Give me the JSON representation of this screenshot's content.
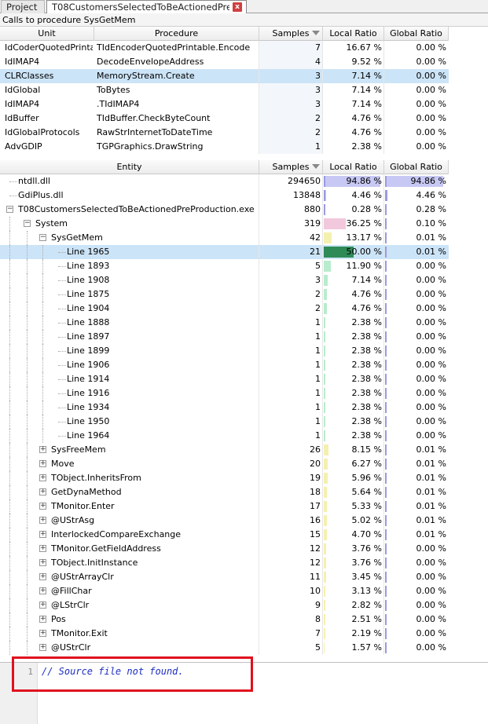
{
  "tabs": {
    "project_label": "Project",
    "active_label": "T08CustomersSelectedToBeActionedPre...",
    "close_glyph": "x"
  },
  "caption": "Calls to procedure SysGetMem",
  "callers": {
    "columns": [
      "Unit",
      "Procedure",
      "Samples",
      "Local Ratio",
      "Global Ratio"
    ],
    "rows": [
      {
        "unit": "IdCoderQuotedPrinta...",
        "procedure": "TIdEncoderQuotedPrintable.Encode",
        "samples": "7",
        "local": "16.67 %",
        "global": "0.00 %",
        "selected": false
      },
      {
        "unit": "IdIMAP4",
        "procedure": "DecodeEnvelopeAddress",
        "samples": "4",
        "local": "9.52 %",
        "global": "0.00 %",
        "selected": false
      },
      {
        "unit": "CLRClasses",
        "procedure": "MemoryStream.Create",
        "samples": "3",
        "local": "7.14 %",
        "global": "0.00 %",
        "selected": true
      },
      {
        "unit": "IdGlobal",
        "procedure": "ToBytes",
        "samples": "3",
        "local": "7.14 %",
        "global": "0.00 %",
        "selected": false
      },
      {
        "unit": "IdIMAP4",
        "procedure": ".TIdIMAP4",
        "samples": "3",
        "local": "7.14 %",
        "global": "0.00 %",
        "selected": false
      },
      {
        "unit": "IdBuffer",
        "procedure": "TIdBuffer.CheckByteCount",
        "samples": "2",
        "local": "4.76 %",
        "global": "0.00 %",
        "selected": false
      },
      {
        "unit": "IdGlobalProtocols",
        "procedure": "RawStrInternetToDateTime",
        "samples": "2",
        "local": "4.76 %",
        "global": "0.00 %",
        "selected": false
      },
      {
        "unit": "AdvGDIP",
        "procedure": "TGPGraphics.DrawString",
        "samples": "1",
        "local": "2.38 %",
        "global": "0.00 %",
        "selected": false
      }
    ]
  },
  "entities": {
    "columns": [
      "Entity",
      "Samples",
      "Local Ratio",
      "Global Ratio"
    ],
    "colors": {
      "blue": "#c8c8f4",
      "pink": "#f2c8dc",
      "yellow": "#f4f0b0",
      "green": "#b8eccc",
      "darkgreen": "#2e8b57",
      "blueline": "#9a9ae0"
    },
    "rows": [
      {
        "name": "ntdll.dll",
        "level": 0,
        "expander": "none",
        "samples": "294650",
        "local": "94.86 %",
        "global": "94.86 %",
        "local_frac": 0.9486,
        "global_frac": 0.9486,
        "color": "blue",
        "selected": false
      },
      {
        "name": "GdiPlus.dll",
        "level": 0,
        "expander": "none",
        "samples": "13848",
        "local": "4.46 %",
        "global": "4.46 %",
        "local_frac": 0.0446,
        "global_frac": 0.0446,
        "color": "blue",
        "selected": false
      },
      {
        "name": "T08CustomersSelectedToBeActionedPreProduction.exe",
        "level": 0,
        "expander": "minus",
        "samples": "880",
        "local": "0.28 %",
        "global": "0.28 %",
        "local_frac": 0.0028,
        "global_frac": 0.0028,
        "color": "blue",
        "selected": false
      },
      {
        "name": "System",
        "level": 1,
        "expander": "minus",
        "samples": "319",
        "local": "36.25 %",
        "global": "0.10 %",
        "local_frac": 0.3625,
        "global_frac": 0.001,
        "color": "pink",
        "selected": false
      },
      {
        "name": "SysGetMem",
        "level": 2,
        "expander": "minus",
        "samples": "42",
        "local": "13.17 %",
        "global": "0.01 %",
        "local_frac": 0.1317,
        "global_frac": 0.0001,
        "color": "yellow",
        "selected": false
      },
      {
        "name": "Line 1965",
        "level": 3,
        "expander": "none",
        "samples": "21",
        "local": "50.00 %",
        "global": "0.01 %",
        "local_frac": 0.5,
        "global_frac": 0.0001,
        "color": "darkgreen",
        "selected": true
      },
      {
        "name": "Line 1893",
        "level": 3,
        "expander": "none",
        "samples": "5",
        "local": "11.90 %",
        "global": "0.00 %",
        "local_frac": 0.119,
        "global_frac": 0,
        "color": "green",
        "selected": false
      },
      {
        "name": "Line 1908",
        "level": 3,
        "expander": "none",
        "samples": "3",
        "local": "7.14 %",
        "global": "0.00 %",
        "local_frac": 0.0714,
        "global_frac": 0,
        "color": "green",
        "selected": false
      },
      {
        "name": "Line 1875",
        "level": 3,
        "expander": "none",
        "samples": "2",
        "local": "4.76 %",
        "global": "0.00 %",
        "local_frac": 0.0476,
        "global_frac": 0,
        "color": "green",
        "selected": false
      },
      {
        "name": "Line 1904",
        "level": 3,
        "expander": "none",
        "samples": "2",
        "local": "4.76 %",
        "global": "0.00 %",
        "local_frac": 0.0476,
        "global_frac": 0,
        "color": "green",
        "selected": false
      },
      {
        "name": "Line 1888",
        "level": 3,
        "expander": "none",
        "samples": "1",
        "local": "2.38 %",
        "global": "0.00 %",
        "local_frac": 0.0238,
        "global_frac": 0,
        "color": "green",
        "selected": false
      },
      {
        "name": "Line 1897",
        "level": 3,
        "expander": "none",
        "samples": "1",
        "local": "2.38 %",
        "global": "0.00 %",
        "local_frac": 0.0238,
        "global_frac": 0,
        "color": "green",
        "selected": false
      },
      {
        "name": "Line 1899",
        "level": 3,
        "expander": "none",
        "samples": "1",
        "local": "2.38 %",
        "global": "0.00 %",
        "local_frac": 0.0238,
        "global_frac": 0,
        "color": "green",
        "selected": false
      },
      {
        "name": "Line 1906",
        "level": 3,
        "expander": "none",
        "samples": "1",
        "local": "2.38 %",
        "global": "0.00 %",
        "local_frac": 0.0238,
        "global_frac": 0,
        "color": "green",
        "selected": false
      },
      {
        "name": "Line 1914",
        "level": 3,
        "expander": "none",
        "samples": "1",
        "local": "2.38 %",
        "global": "0.00 %",
        "local_frac": 0.0238,
        "global_frac": 0,
        "color": "green",
        "selected": false
      },
      {
        "name": "Line 1916",
        "level": 3,
        "expander": "none",
        "samples": "1",
        "local": "2.38 %",
        "global": "0.00 %",
        "local_frac": 0.0238,
        "global_frac": 0,
        "color": "green",
        "selected": false
      },
      {
        "name": "Line 1934",
        "level": 3,
        "expander": "none",
        "samples": "1",
        "local": "2.38 %",
        "global": "0.00 %",
        "local_frac": 0.0238,
        "global_frac": 0,
        "color": "green",
        "selected": false
      },
      {
        "name": "Line 1950",
        "level": 3,
        "expander": "none",
        "samples": "1",
        "local": "2.38 %",
        "global": "0.00 %",
        "local_frac": 0.0238,
        "global_frac": 0,
        "color": "green",
        "selected": false
      },
      {
        "name": "Line 1964",
        "level": 3,
        "expander": "none",
        "samples": "1",
        "local": "2.38 %",
        "global": "0.00 %",
        "local_frac": 0.0238,
        "global_frac": 0,
        "color": "green",
        "selected": false
      },
      {
        "name": "SysFreeMem",
        "level": 2,
        "expander": "plus",
        "samples": "26",
        "local": "8.15 %",
        "global": "0.01 %",
        "local_frac": 0.0815,
        "global_frac": 0.0001,
        "color": "yellow",
        "selected": false
      },
      {
        "name": "Move",
        "level": 2,
        "expander": "plus",
        "samples": "20",
        "local": "6.27 %",
        "global": "0.01 %",
        "local_frac": 0.0627,
        "global_frac": 0.0001,
        "color": "yellow",
        "selected": false
      },
      {
        "name": "TObject.InheritsFrom",
        "level": 2,
        "expander": "plus",
        "samples": "19",
        "local": "5.96 %",
        "global": "0.01 %",
        "local_frac": 0.0596,
        "global_frac": 0.0001,
        "color": "yellow",
        "selected": false
      },
      {
        "name": "GetDynaMethod",
        "level": 2,
        "expander": "plus",
        "samples": "18",
        "local": "5.64 %",
        "global": "0.01 %",
        "local_frac": 0.0564,
        "global_frac": 0.0001,
        "color": "yellow",
        "selected": false
      },
      {
        "name": "TMonitor.Enter",
        "level": 2,
        "expander": "plus",
        "samples": "17",
        "local": "5.33 %",
        "global": "0.01 %",
        "local_frac": 0.0533,
        "global_frac": 0.0001,
        "color": "yellow",
        "selected": false
      },
      {
        "name": "@UStrAsg",
        "level": 2,
        "expander": "plus",
        "samples": "16",
        "local": "5.02 %",
        "global": "0.01 %",
        "local_frac": 0.0502,
        "global_frac": 0.0001,
        "color": "yellow",
        "selected": false
      },
      {
        "name": "InterlockedCompareExchange",
        "level": 2,
        "expander": "plus",
        "samples": "15",
        "local": "4.70 %",
        "global": "0.01 %",
        "local_frac": 0.047,
        "global_frac": 0.0001,
        "color": "yellow",
        "selected": false
      },
      {
        "name": "TMonitor.GetFieldAddress",
        "level": 2,
        "expander": "plus",
        "samples": "12",
        "local": "3.76 %",
        "global": "0.00 %",
        "local_frac": 0.0376,
        "global_frac": 0,
        "color": "yellow",
        "selected": false
      },
      {
        "name": "TObject.InitInstance",
        "level": 2,
        "expander": "plus",
        "samples": "12",
        "local": "3.76 %",
        "global": "0.00 %",
        "local_frac": 0.0376,
        "global_frac": 0,
        "color": "yellow",
        "selected": false
      },
      {
        "name": "@UStrArrayClr",
        "level": 2,
        "expander": "plus",
        "samples": "11",
        "local": "3.45 %",
        "global": "0.00 %",
        "local_frac": 0.0345,
        "global_frac": 0,
        "color": "yellow",
        "selected": false
      },
      {
        "name": "@FillChar",
        "level": 2,
        "expander": "plus",
        "samples": "10",
        "local": "3.13 %",
        "global": "0.00 %",
        "local_frac": 0.0313,
        "global_frac": 0,
        "color": "yellow",
        "selected": false
      },
      {
        "name": "@LStrClr",
        "level": 2,
        "expander": "plus",
        "samples": "9",
        "local": "2.82 %",
        "global": "0.00 %",
        "local_frac": 0.0282,
        "global_frac": 0,
        "color": "yellow",
        "selected": false
      },
      {
        "name": "Pos",
        "level": 2,
        "expander": "plus",
        "samples": "8",
        "local": "2.51 %",
        "global": "0.00 %",
        "local_frac": 0.0251,
        "global_frac": 0,
        "color": "yellow",
        "selected": false
      },
      {
        "name": "TMonitor.Exit",
        "level": 2,
        "expander": "plus",
        "samples": "7",
        "local": "2.19 %",
        "global": "0.00 %",
        "local_frac": 0.0219,
        "global_frac": 0,
        "color": "yellow",
        "selected": false
      },
      {
        "name": "@UStrClr",
        "level": 2,
        "expander": "plus",
        "samples": "5",
        "local": "1.57 %",
        "global": "0.00 %",
        "local_frac": 0.0157,
        "global_frac": 0,
        "color": "yellow",
        "selected": false
      }
    ]
  },
  "editor": {
    "line_number": "1",
    "code": "// Source file not found."
  }
}
